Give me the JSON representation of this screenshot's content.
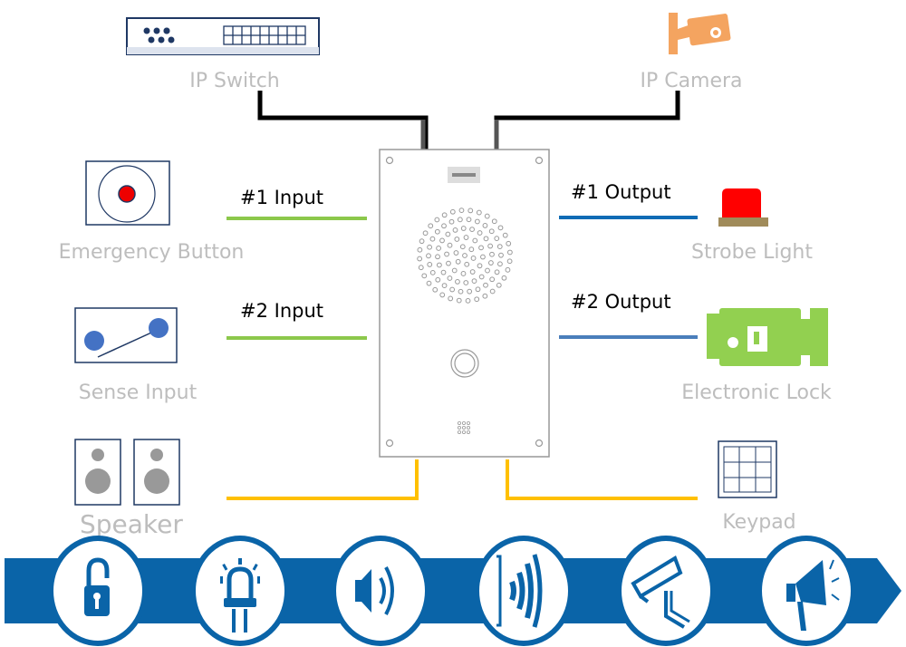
{
  "devices": {
    "ip_switch": "IP Switch",
    "ip_camera": "IP Camera",
    "emergency_button": "Emergency Button",
    "sense_input": "Sense Input",
    "speaker": "Speaker",
    "strobe_light": "Strobe Light",
    "electronic_lock": "Electronic Lock",
    "keypad": "Keypad"
  },
  "connections": {
    "input1": "#1 Input",
    "input2": "#2 Input",
    "output1": "#1 Output",
    "output2": "#2 Output"
  },
  "banner_icons": [
    "unlock-icon",
    "strobe-light-icon",
    "speaker-icon",
    "sound-wave-icon",
    "cctv-camera-icon",
    "megaphone-icon"
  ],
  "colors": {
    "banner_blue": "#0a64a8",
    "input_green": "#8cc84b",
    "output_blue": "#2e75b6",
    "audio_yellow": "#ffc000",
    "network_black": "#000000",
    "camera_orange": "#f4a460",
    "lock_green": "#92d050",
    "strobe_red": "#ff0000"
  }
}
